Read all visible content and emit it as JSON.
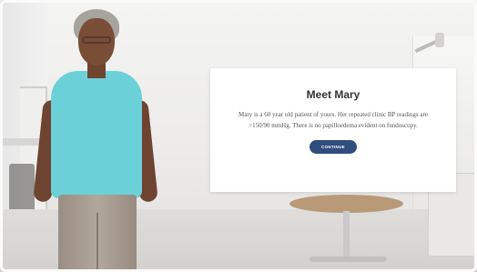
{
  "dialog": {
    "title": "Meet Mary",
    "body": "Mary is a 60 year old patient of yours. Her repeated clinic BP readings are >150/90 mmHg. There is no papilloedema evident on fundoscopy.",
    "button_label": "CONTINUE"
  },
  "colors": {
    "button_bg": "#2f4d7d",
    "shirt": "#6cd0d8",
    "card_bg": "#ffffff"
  }
}
